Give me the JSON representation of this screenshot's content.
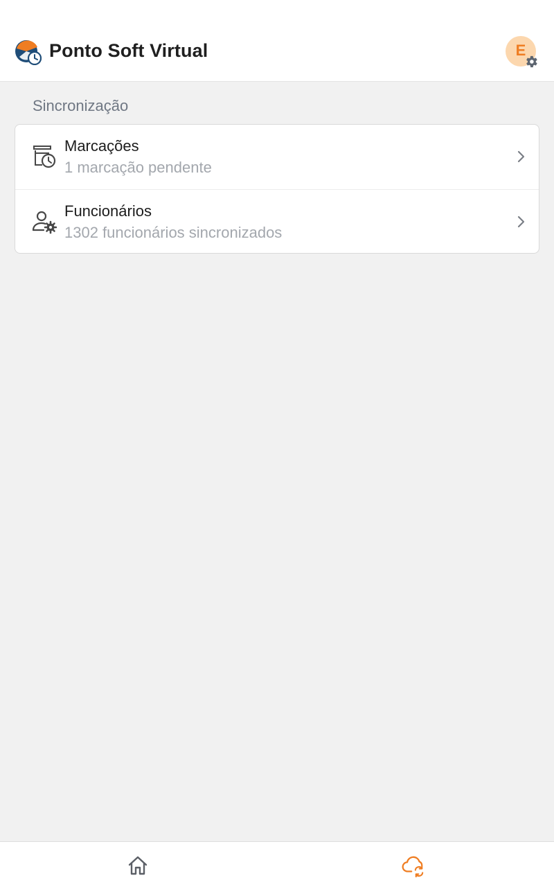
{
  "header": {
    "title": "Ponto Soft Virtual",
    "logo_icon": "clock-logo-icon",
    "avatar_initial": "E",
    "avatar_badge_icon": "gear-icon"
  },
  "sync": {
    "section_title": "Sincronização",
    "items": [
      {
        "title": "Marcações",
        "subtitle": "1 marcação pendente",
        "icon": "calendar-clock-icon"
      },
      {
        "title": "Funcionários",
        "subtitle": "1302 funcionários sincronizados",
        "icon": "user-gear-icon"
      }
    ]
  },
  "bottom_nav": {
    "items": [
      {
        "icon": "home-icon",
        "active": false
      },
      {
        "icon": "cloud-sync-icon",
        "active": true
      }
    ]
  },
  "colors": {
    "accent": "#ef7d22",
    "avatar_bg": "#fcd7ae",
    "logo_blue": "#1f4d78",
    "text_primary": "#1c1c1c",
    "text_muted": "#a3a7ad",
    "background": "#f1f1f1"
  }
}
